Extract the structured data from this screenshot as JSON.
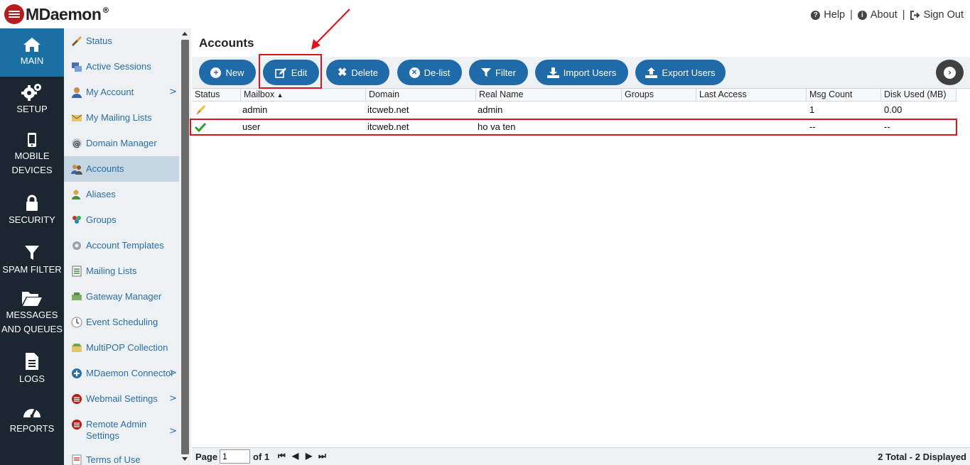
{
  "brand": {
    "name": "MDaemon",
    "reg": "®"
  },
  "top_links": [
    {
      "label": "Help",
      "icon": "help-circle-icon"
    },
    {
      "label": "About",
      "icon": "info-circle-icon"
    },
    {
      "label": "Sign Out",
      "icon": "sign-out-icon"
    }
  ],
  "nav": [
    {
      "label": "MAIN",
      "icon": "home-icon",
      "active": true
    },
    {
      "label": "SETUP",
      "icon": "gears-icon"
    },
    {
      "label_lines": [
        "MOBILE",
        "DEVICES"
      ],
      "icon": "mobile-phone-icon"
    },
    {
      "label": "SECURITY",
      "icon": "lock-icon"
    },
    {
      "label": "SPAM FILTER",
      "icon": "funnel-icon"
    },
    {
      "label_lines": [
        "MESSAGES",
        "AND QUEUES"
      ],
      "icon": "folder-open-icon"
    },
    {
      "label": "LOGS",
      "icon": "document-icon"
    },
    {
      "label": "REPORTS",
      "icon": "gauge-icon"
    }
  ],
  "submenu": [
    {
      "label": "Status",
      "icon": "wrench-icon"
    },
    {
      "label": "Active Sessions",
      "icon": "sessions-icon"
    },
    {
      "label": "My Account",
      "icon": "user-icon",
      "arrow": ">"
    },
    {
      "label": "My Mailing Lists",
      "icon": "mailing-lists-icon"
    },
    {
      "label": "Domain Manager",
      "icon": "at-sign-icon"
    },
    {
      "label": "Accounts",
      "icon": "users-icon",
      "active": true
    },
    {
      "label": "Aliases",
      "icon": "alias-icon"
    },
    {
      "label": "Groups",
      "icon": "groups-icon"
    },
    {
      "label": "Account Templates",
      "icon": "template-gear-icon"
    },
    {
      "label": "Mailing Lists",
      "icon": "list-icon"
    },
    {
      "label": "Gateway Manager",
      "icon": "gateway-icon"
    },
    {
      "label": "Event Scheduling",
      "icon": "clock-icon"
    },
    {
      "label": "MultiPOP Collection",
      "icon": "multipop-icon"
    },
    {
      "label": "MDaemon Connector",
      "icon": "connector-icon",
      "arrow": ">"
    },
    {
      "label": "Webmail Settings",
      "icon": "webmail-icon",
      "arrow": ">"
    },
    {
      "label_lines": [
        "Remote Admin",
        "Settings"
      ],
      "icon": "remote-admin-icon",
      "arrow": ">"
    },
    {
      "label": "Terms of Use",
      "icon": "terms-icon"
    }
  ],
  "page": {
    "title": "Accounts"
  },
  "toolbar": [
    {
      "label": "New",
      "icon": "plus-circle-icon"
    },
    {
      "label": "Edit",
      "icon": "edit-icon"
    },
    {
      "label": "Delete",
      "icon": "x-icon"
    },
    {
      "label": "De-list",
      "icon": "x-circle-icon"
    },
    {
      "label": "Filter",
      "icon": "funnel-icon"
    },
    {
      "label": "Import Users",
      "icon": "download-icon"
    },
    {
      "label": "Export Users",
      "icon": "upload-icon"
    }
  ],
  "table": {
    "columns": [
      "Status",
      "Mailbox",
      "Domain",
      "Real Name",
      "Groups",
      "Last Access",
      "Msg Count",
      "Disk Used (MB)"
    ],
    "sort_indicator": "▲",
    "rows": [
      {
        "status_icon": "admin-key-icon",
        "cells": [
          "",
          "admin",
          "itcweb.net",
          "admin",
          "",
          "",
          "1",
          "0.00"
        ]
      },
      {
        "status_icon": "checkmark-icon",
        "cells": [
          "",
          "user",
          "itcweb.net",
          "ho va ten",
          "",
          "",
          "--",
          "--"
        ]
      }
    ]
  },
  "pager": {
    "page_label": "Page",
    "page_value": "1",
    "of_label": "of 1",
    "nav_first": "⏮",
    "nav_prev": "◀",
    "nav_next": "▶",
    "nav_last": "⏭",
    "total": "2 Total - 2 Displayed"
  },
  "colors": {
    "nav_bg": "#1b2631",
    "nav_active": "#1a6fa4",
    "button": "#1f6aa8",
    "link": "#2a6ea6",
    "annotation": "#e0121c"
  }
}
